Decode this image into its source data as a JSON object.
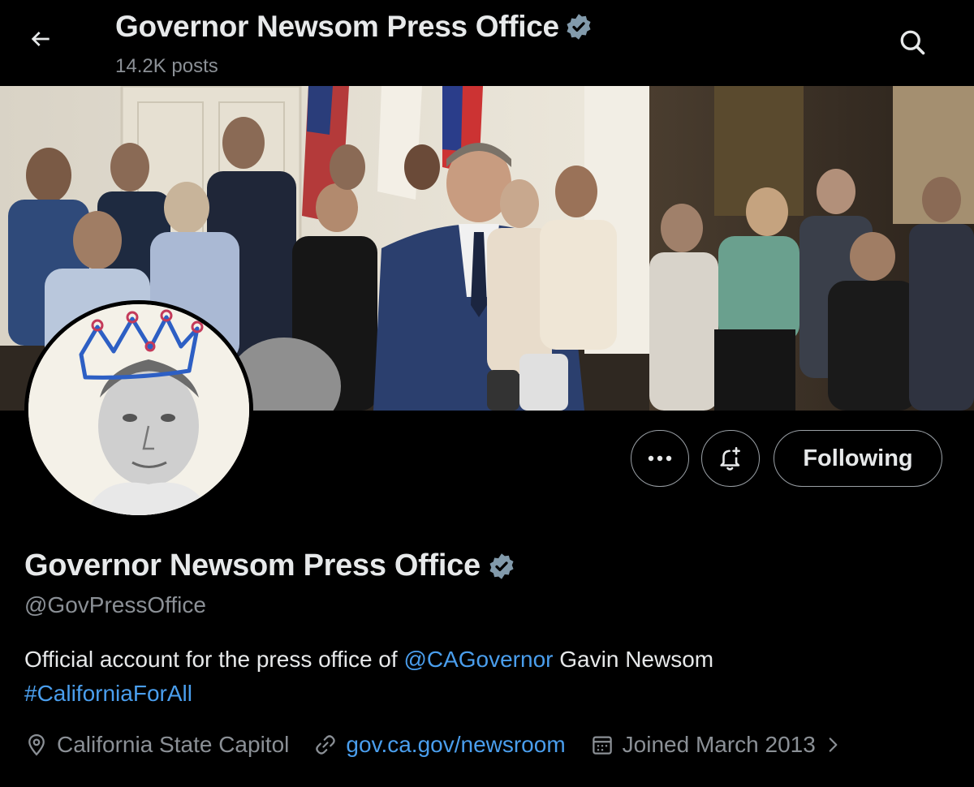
{
  "header": {
    "title": "Governor Newsom Press Office",
    "posts_count": "14.2K posts"
  },
  "icons": {
    "back": "back-arrow-icon",
    "search": "search-icon",
    "verified": "verified-badge-icon",
    "more": "more-icon",
    "notify": "notification-bell-icon",
    "location": "location-pin-icon",
    "link": "link-icon",
    "calendar": "calendar-icon",
    "chevron": "chevron-right-icon"
  },
  "actions": {
    "following_label": "Following"
  },
  "profile": {
    "display_name": "Governor Newsom Press Office",
    "handle": "@GovPressOffice",
    "bio_prefix": "Official account for the press office of ",
    "bio_mention": "@CAGovernor",
    "bio_suffix": " Gavin Newsom",
    "bio_hashtag": "#CaliforniaForAll",
    "location": "California State Capitol",
    "website": "gov.ca.gov/newsroom",
    "joined": "Joined March 2013"
  },
  "colors": {
    "background": "#000000",
    "text_primary": "#e7e9ea",
    "text_secondary": "#8b9096",
    "link": "#4a9eed",
    "verified_badge": "#829aab"
  }
}
